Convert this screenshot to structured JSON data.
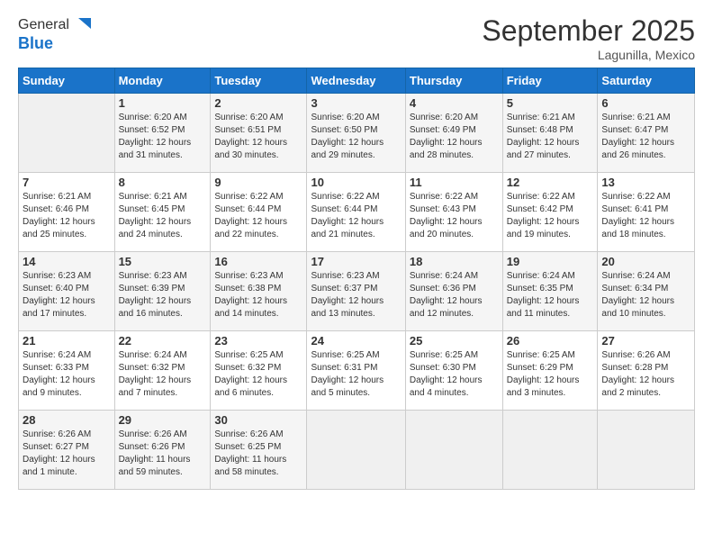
{
  "logo": {
    "general": "General",
    "blue": "Blue"
  },
  "header": {
    "title": "September 2025",
    "subtitle": "Lagunilla, Mexico"
  },
  "weekdays": [
    "Sunday",
    "Monday",
    "Tuesday",
    "Wednesday",
    "Thursday",
    "Friday",
    "Saturday"
  ],
  "weeks": [
    [
      {
        "day": "",
        "info": ""
      },
      {
        "day": "1",
        "info": "Sunrise: 6:20 AM\nSunset: 6:52 PM\nDaylight: 12 hours\nand 31 minutes."
      },
      {
        "day": "2",
        "info": "Sunrise: 6:20 AM\nSunset: 6:51 PM\nDaylight: 12 hours\nand 30 minutes."
      },
      {
        "day": "3",
        "info": "Sunrise: 6:20 AM\nSunset: 6:50 PM\nDaylight: 12 hours\nand 29 minutes."
      },
      {
        "day": "4",
        "info": "Sunrise: 6:20 AM\nSunset: 6:49 PM\nDaylight: 12 hours\nand 28 minutes."
      },
      {
        "day": "5",
        "info": "Sunrise: 6:21 AM\nSunset: 6:48 PM\nDaylight: 12 hours\nand 27 minutes."
      },
      {
        "day": "6",
        "info": "Sunrise: 6:21 AM\nSunset: 6:47 PM\nDaylight: 12 hours\nand 26 minutes."
      }
    ],
    [
      {
        "day": "7",
        "info": "Sunrise: 6:21 AM\nSunset: 6:46 PM\nDaylight: 12 hours\nand 25 minutes."
      },
      {
        "day": "8",
        "info": "Sunrise: 6:21 AM\nSunset: 6:45 PM\nDaylight: 12 hours\nand 24 minutes."
      },
      {
        "day": "9",
        "info": "Sunrise: 6:22 AM\nSunset: 6:44 PM\nDaylight: 12 hours\nand 22 minutes."
      },
      {
        "day": "10",
        "info": "Sunrise: 6:22 AM\nSunset: 6:44 PM\nDaylight: 12 hours\nand 21 minutes."
      },
      {
        "day": "11",
        "info": "Sunrise: 6:22 AM\nSunset: 6:43 PM\nDaylight: 12 hours\nand 20 minutes."
      },
      {
        "day": "12",
        "info": "Sunrise: 6:22 AM\nSunset: 6:42 PM\nDaylight: 12 hours\nand 19 minutes."
      },
      {
        "day": "13",
        "info": "Sunrise: 6:22 AM\nSunset: 6:41 PM\nDaylight: 12 hours\nand 18 minutes."
      }
    ],
    [
      {
        "day": "14",
        "info": "Sunrise: 6:23 AM\nSunset: 6:40 PM\nDaylight: 12 hours\nand 17 minutes."
      },
      {
        "day": "15",
        "info": "Sunrise: 6:23 AM\nSunset: 6:39 PM\nDaylight: 12 hours\nand 16 minutes."
      },
      {
        "day": "16",
        "info": "Sunrise: 6:23 AM\nSunset: 6:38 PM\nDaylight: 12 hours\nand 14 minutes."
      },
      {
        "day": "17",
        "info": "Sunrise: 6:23 AM\nSunset: 6:37 PM\nDaylight: 12 hours\nand 13 minutes."
      },
      {
        "day": "18",
        "info": "Sunrise: 6:24 AM\nSunset: 6:36 PM\nDaylight: 12 hours\nand 12 minutes."
      },
      {
        "day": "19",
        "info": "Sunrise: 6:24 AM\nSunset: 6:35 PM\nDaylight: 12 hours\nand 11 minutes."
      },
      {
        "day": "20",
        "info": "Sunrise: 6:24 AM\nSunset: 6:34 PM\nDaylight: 12 hours\nand 10 minutes."
      }
    ],
    [
      {
        "day": "21",
        "info": "Sunrise: 6:24 AM\nSunset: 6:33 PM\nDaylight: 12 hours\nand 9 minutes."
      },
      {
        "day": "22",
        "info": "Sunrise: 6:24 AM\nSunset: 6:32 PM\nDaylight: 12 hours\nand 7 minutes."
      },
      {
        "day": "23",
        "info": "Sunrise: 6:25 AM\nSunset: 6:32 PM\nDaylight: 12 hours\nand 6 minutes."
      },
      {
        "day": "24",
        "info": "Sunrise: 6:25 AM\nSunset: 6:31 PM\nDaylight: 12 hours\nand 5 minutes."
      },
      {
        "day": "25",
        "info": "Sunrise: 6:25 AM\nSunset: 6:30 PM\nDaylight: 12 hours\nand 4 minutes."
      },
      {
        "day": "26",
        "info": "Sunrise: 6:25 AM\nSunset: 6:29 PM\nDaylight: 12 hours\nand 3 minutes."
      },
      {
        "day": "27",
        "info": "Sunrise: 6:26 AM\nSunset: 6:28 PM\nDaylight: 12 hours\nand 2 minutes."
      }
    ],
    [
      {
        "day": "28",
        "info": "Sunrise: 6:26 AM\nSunset: 6:27 PM\nDaylight: 12 hours\nand 1 minute."
      },
      {
        "day": "29",
        "info": "Sunrise: 6:26 AM\nSunset: 6:26 PM\nDaylight: 11 hours\nand 59 minutes."
      },
      {
        "day": "30",
        "info": "Sunrise: 6:26 AM\nSunset: 6:25 PM\nDaylight: 11 hours\nand 58 minutes."
      },
      {
        "day": "",
        "info": ""
      },
      {
        "day": "",
        "info": ""
      },
      {
        "day": "",
        "info": ""
      },
      {
        "day": "",
        "info": ""
      }
    ]
  ]
}
